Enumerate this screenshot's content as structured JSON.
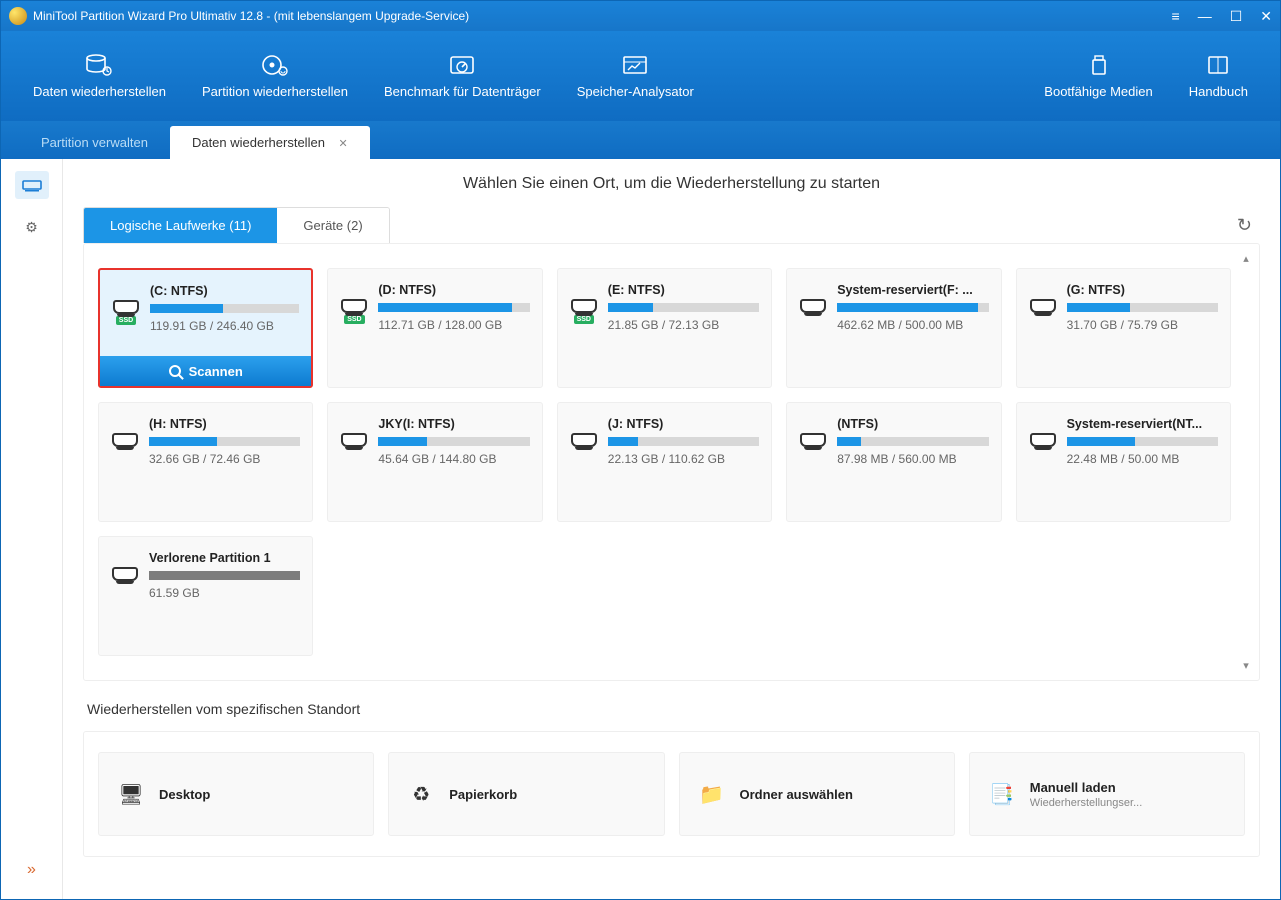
{
  "title": "MiniTool Partition Wizard Pro Ultimativ 12.8 - (mit lebenslangem Upgrade-Service)",
  "toolbar": {
    "recover_data": "Daten wiederherstellen",
    "recover_partition": "Partition wiederherstellen",
    "benchmark": "Benchmark für Datenträger",
    "space_analyzer": "Speicher-Analysator",
    "bootable": "Bootfähige Medien",
    "manual": "Handbuch"
  },
  "tabs": {
    "manage": "Partition verwalten",
    "recover": "Daten wiederherstellen"
  },
  "heading": "Wählen Sie einen Ort, um die Wiederherstellung zu starten",
  "subtabs": {
    "logical": "Logische Laufwerke (11)",
    "devices": "Geräte (2)"
  },
  "scan_label": "Scannen",
  "drives": [
    {
      "name": "(C: NTFS)",
      "cap": "119.91 GB / 246.40 GB",
      "pct": 49,
      "ssd": true,
      "selected": true,
      "lost": false
    },
    {
      "name": "(D: NTFS)",
      "cap": "112.71 GB / 128.00 GB",
      "pct": 88,
      "ssd": true,
      "selected": false,
      "lost": false
    },
    {
      "name": "(E: NTFS)",
      "cap": "21.85 GB / 72.13 GB",
      "pct": 30,
      "ssd": true,
      "selected": false,
      "lost": false
    },
    {
      "name": "System-reserviert(F: ...",
      "cap": "462.62 MB / 500.00 MB",
      "pct": 93,
      "ssd": false,
      "selected": false,
      "lost": false
    },
    {
      "name": "(G: NTFS)",
      "cap": "31.70 GB / 75.79 GB",
      "pct": 42,
      "ssd": false,
      "selected": false,
      "lost": false
    },
    {
      "name": "(H: NTFS)",
      "cap": "32.66 GB / 72.46 GB",
      "pct": 45,
      "ssd": false,
      "selected": false,
      "lost": false
    },
    {
      "name": "JKY(I: NTFS)",
      "cap": "45.64 GB / 144.80 GB",
      "pct": 32,
      "ssd": false,
      "selected": false,
      "lost": false
    },
    {
      "name": "(J: NTFS)",
      "cap": "22.13 GB / 110.62 GB",
      "pct": 20,
      "ssd": false,
      "selected": false,
      "lost": false
    },
    {
      "name": "(NTFS)",
      "cap": "87.98 MB / 560.00 MB",
      "pct": 16,
      "ssd": false,
      "selected": false,
      "lost": false
    },
    {
      "name": "System-reserviert(NT...",
      "cap": "22.48 MB / 50.00 MB",
      "pct": 45,
      "ssd": false,
      "selected": false,
      "lost": false
    },
    {
      "name": "Verlorene Partition 1",
      "cap": "61.59 GB",
      "pct": 100,
      "ssd": false,
      "selected": false,
      "lost": true
    }
  ],
  "section2": "Wiederherstellen vom spezifischen Standort",
  "locations": [
    {
      "title": "Desktop",
      "sub": ""
    },
    {
      "title": "Papierkorb",
      "sub": ""
    },
    {
      "title": "Ordner auswählen",
      "sub": ""
    },
    {
      "title": "Manuell laden",
      "sub": "Wiederherstellungser..."
    }
  ]
}
